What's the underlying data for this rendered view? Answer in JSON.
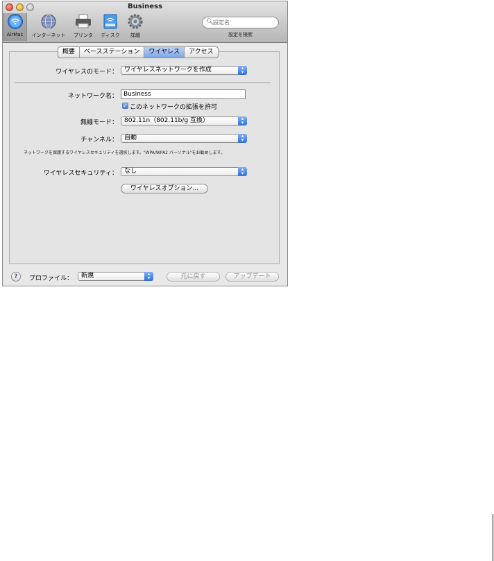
{
  "window": {
    "title": "Business"
  },
  "toolbar": {
    "items": [
      {
        "label": "AirMac",
        "icon": "airmac-icon",
        "selected": true
      },
      {
        "label": "インターネット",
        "icon": "globe-icon"
      },
      {
        "label": "プリンタ",
        "icon": "printer-icon"
      },
      {
        "label": "ディスク",
        "icon": "disk-icon"
      },
      {
        "label": "詳細",
        "icon": "gear-icon"
      }
    ],
    "search": {
      "placeholder": "設定名",
      "label": "設定を検索"
    }
  },
  "tabs": [
    {
      "label": "概要"
    },
    {
      "label": "ベースステーション"
    },
    {
      "label": "ワイヤレス",
      "active": true
    },
    {
      "label": "アクセス"
    }
  ],
  "wireless": {
    "mode_label": "ワイヤレスのモード：",
    "mode_value": "ワイヤレスネットワークを作成",
    "network_name_label": "ネットワーク名：",
    "network_name_value": "Business",
    "extend_checkbox_label": "このネットワークの拡張を許可",
    "extend_checked": true,
    "radio_mode_label": "無線モード：",
    "radio_mode_value": "802.11n（802.11b/g 互換）",
    "channel_label": "チャンネル：",
    "channel_value": "自動",
    "info_text": "ネットワークを保護するワイヤレスセキュリティを選択します。\"WPA/WPA2 パーソナル\"をお勧めします。",
    "security_label": "ワイヤレスセキュリティ：",
    "security_value": "なし",
    "options_button": "ワイヤレスオプション..."
  },
  "footer": {
    "profile_label": "プロファイル：",
    "profile_value": "新規",
    "revert_button": "元に戻す",
    "update_button": "アップデート",
    "help_glyph": "?"
  }
}
